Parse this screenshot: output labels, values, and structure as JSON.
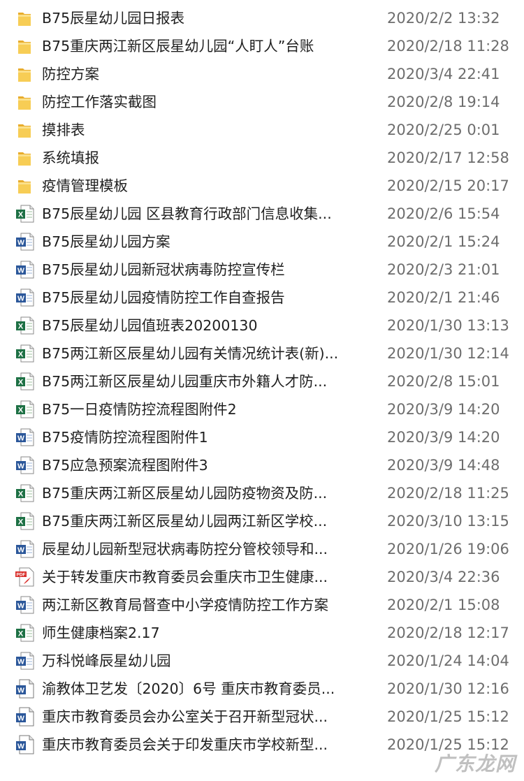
{
  "files": [
    {
      "name": "B75辰星幼儿园日报表",
      "date": "2020/2/2 13:32",
      "icon": "folder-icon"
    },
    {
      "name": "B75重庆两江新区辰星幼儿园“人盯人”台账",
      "date": "2020/2/18 11:28",
      "icon": "folder-icon"
    },
    {
      "name": "防控方案",
      "date": "2020/3/4 22:41",
      "icon": "folder-icon"
    },
    {
      "name": "防控工作落实截图",
      "date": "2020/2/8 19:14",
      "icon": "folder-icon"
    },
    {
      "name": "摸排表",
      "date": "2020/2/25 0:01",
      "icon": "folder-icon"
    },
    {
      "name": "系统填报",
      "date": "2020/2/17 12:58",
      "icon": "folder-icon"
    },
    {
      "name": "疫情管理模板",
      "date": "2020/2/15 20:17",
      "icon": "folder-icon"
    },
    {
      "name": "B75辰星幼儿园 区县教育行政部门信息收集...",
      "date": "2020/2/6 15:54",
      "icon": "excel-icon"
    },
    {
      "name": "B75辰星幼儿园方案",
      "date": "2020/2/1 15:24",
      "icon": "word-icon"
    },
    {
      "name": "B75辰星幼儿园新冠状病毒防控宣传栏",
      "date": "2020/2/3 21:01",
      "icon": "word-icon"
    },
    {
      "name": "B75辰星幼儿园疫情防控工作自查报告",
      "date": "2020/2/1 21:46",
      "icon": "word-icon"
    },
    {
      "name": "B75辰星幼儿园值班表20200130",
      "date": "2020/1/30 13:13",
      "icon": "excel-icon"
    },
    {
      "name": "B75两江新区辰星幼儿园有关情况统计表(新)...",
      "date": "2020/1/30 12:14",
      "icon": "excel-icon"
    },
    {
      "name": "B75两江新区辰星幼儿园重庆市外籍人才防...",
      "date": "2020/2/8 15:01",
      "icon": "excel-icon"
    },
    {
      "name": "B75一日疫情防控流程图附件2",
      "date": "2020/3/9 14:20",
      "icon": "excel-icon"
    },
    {
      "name": "B75疫情防控流程图附件1",
      "date": "2020/3/9 14:20",
      "icon": "word-icon"
    },
    {
      "name": "B75应急预案流程图附件3",
      "date": "2020/3/9 14:48",
      "icon": "word-icon"
    },
    {
      "name": "B75重庆两江新区辰星幼儿园防疫物资及防...",
      "date": "2020/2/18 11:25",
      "icon": "excel-icon"
    },
    {
      "name": "B75重庆两江新区辰星幼儿园两江新区学校...",
      "date": "2020/3/10 13:15",
      "icon": "excel-icon"
    },
    {
      "name": "辰星幼儿园新型冠状病毒防控分管校领导和...",
      "date": "2020/1/26 19:06",
      "icon": "word-icon"
    },
    {
      "name": "关于转发重庆市教育委员会重庆市卫生健康...",
      "date": "2020/3/4 22:36",
      "icon": "pdf-icon"
    },
    {
      "name": "两江新区教育局督查中小学疫情防控工作方案",
      "date": "2020/2/1 15:08",
      "icon": "word-icon"
    },
    {
      "name": "师生健康档案2.17",
      "date": "2020/2/18 12:17",
      "icon": "excel-icon"
    },
    {
      "name": "万科悦峰辰星幼儿园",
      "date": "2020/1/24 14:04",
      "icon": "word-icon"
    },
    {
      "name": "渝教体卫艺发〔2020〕6号 重庆市教育委员...",
      "date": "2020/1/30 12:16",
      "icon": "word-doc-icon"
    },
    {
      "name": "重庆市教育委员会办公室关于召开新型冠状...",
      "date": "2020/1/25 15:12",
      "icon": "word-doc-icon"
    },
    {
      "name": "重庆市教育委员会关于印发重庆市学校新型...",
      "date": "2020/1/25 15:12",
      "icon": "word-doc-icon"
    }
  ],
  "watermark": "广东龙网",
  "colors": {
    "folder": "#f5c542",
    "excel": "#1e7145",
    "word": "#2b579a",
    "pdf": "#d9302c"
  }
}
